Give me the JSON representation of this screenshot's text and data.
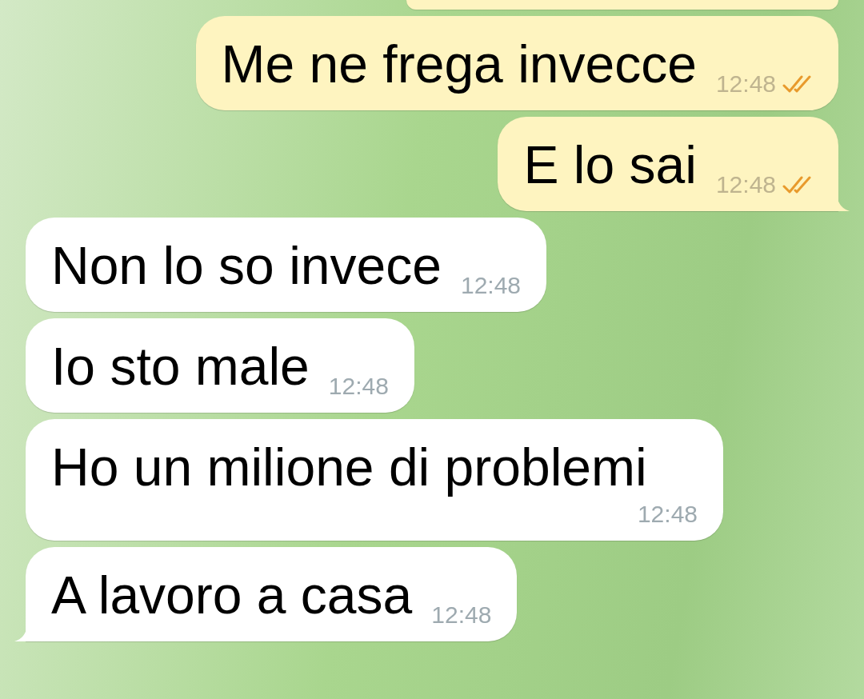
{
  "messages": [
    {
      "text": "Me ne frega invecce",
      "time": "12:48",
      "outgoing": true,
      "read": true,
      "tail": false
    },
    {
      "text": "E lo sai",
      "time": "12:48",
      "outgoing": true,
      "read": true,
      "tail": true
    },
    {
      "text": "Non lo so invece",
      "time": "12:48",
      "outgoing": false,
      "tail": false
    },
    {
      "text": "Io sto male",
      "time": "12:48",
      "outgoing": false,
      "tail": false
    },
    {
      "text": "Ho un milione di problemi",
      "time": "12:48",
      "outgoing": false,
      "tail": false
    },
    {
      "text": "A lavoro a casa",
      "time": "12:48",
      "outgoing": false,
      "tail": true
    }
  ]
}
